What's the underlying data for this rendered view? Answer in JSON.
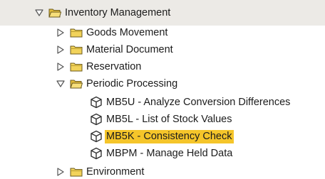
{
  "tree": {
    "root": {
      "label": "Inventory Management",
      "state": "expanded",
      "icon": "folder-open-icon"
    },
    "children": [
      {
        "label": "Goods Movement",
        "state": "collapsed",
        "icon": "folder-icon"
      },
      {
        "label": "Material Document",
        "state": "collapsed",
        "icon": "folder-icon"
      },
      {
        "label": "Reservation",
        "state": "collapsed",
        "icon": "folder-icon"
      },
      {
        "label": "Periodic Processing",
        "state": "expanded",
        "icon": "folder-open-icon",
        "transactions": [
          {
            "label": "MB5U - Analyze Conversion Differences",
            "icon": "transaction-cube-icon"
          },
          {
            "label": "MB5L - List of Stock Values",
            "icon": "transaction-cube-icon"
          },
          {
            "label": "MB5K - Consistency Check",
            "icon": "transaction-cube-icon",
            "selected": true
          },
          {
            "label": "MBPM - Manage Held Data",
            "icon": "transaction-cube-icon"
          }
        ]
      },
      {
        "label": "Environment",
        "state": "collapsed",
        "icon": "folder-icon"
      }
    ]
  },
  "colors": {
    "selection_highlight": "#f5c52a",
    "folder_fill": "#f2d35a",
    "top_band": "#eceae6"
  }
}
